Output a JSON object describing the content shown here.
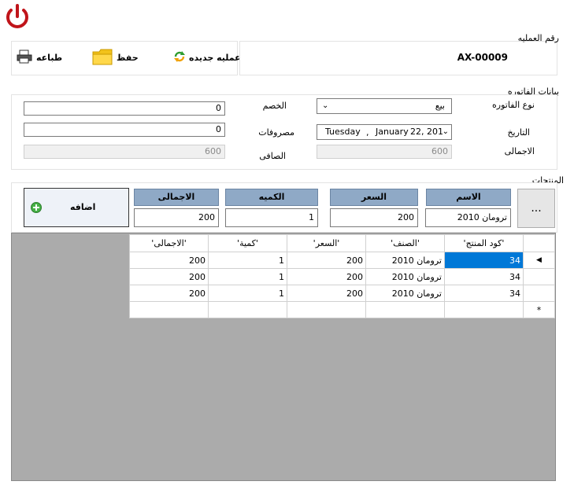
{
  "toolbar": {
    "print_label": "طباعه",
    "save_label": "حفظ",
    "new_label": "عمليه جديده"
  },
  "operation": {
    "label": "رقم العمليه",
    "number": "AX-00009"
  },
  "invoice": {
    "section_label": "بيانات الفاتوره",
    "type_label": "نوع الفاتوره",
    "type_value": "بيع",
    "date_label": "التاريخ",
    "date_day": "Tuesday",
    "date_sep": ",",
    "date_month": "January",
    "date_rest": "22, 201",
    "total_label": "الاجمالى",
    "total_value": "600",
    "discount_label": "الخصم",
    "discount_value": "0",
    "expenses_label": "مصروفات",
    "expenses_value": "0",
    "net_label": "الصافى",
    "net_value": "600"
  },
  "products": {
    "section_label": "المنتجات",
    "browse_label": "...",
    "add_label": "اضافه",
    "name_header": "الاسم",
    "price_header": "السعر",
    "qty_header": "الكميه",
    "total_header": "الاجمالى",
    "name_value": "ترومان 2010",
    "price_value": "200",
    "qty_value": "1",
    "total_value": "200"
  },
  "grid": {
    "columns": [
      "'كود المنتج'",
      "'الصنف'",
      "'السعر'",
      "'كمية'",
      "'الاجمالى'"
    ],
    "rows": [
      [
        "34",
        "ترومان 2010",
        "200",
        "1",
        "200"
      ],
      [
        "34",
        "ترومان 2010",
        "200",
        "1",
        "200"
      ],
      [
        "34",
        "ترومان 2010",
        "200",
        "1",
        "200"
      ]
    ],
    "new_row_marker": "*",
    "current_row_marker": "◀"
  },
  "colors": {
    "power": "#c0141a",
    "header_button": "#8fa9c6",
    "selected_cell": "#0078d7",
    "grid_background": "#ababab"
  },
  "icons": {
    "power": "power-icon",
    "print": "printer-icon",
    "save": "folder-icon",
    "new": "refresh-icon",
    "add": "plus-circle-icon"
  }
}
